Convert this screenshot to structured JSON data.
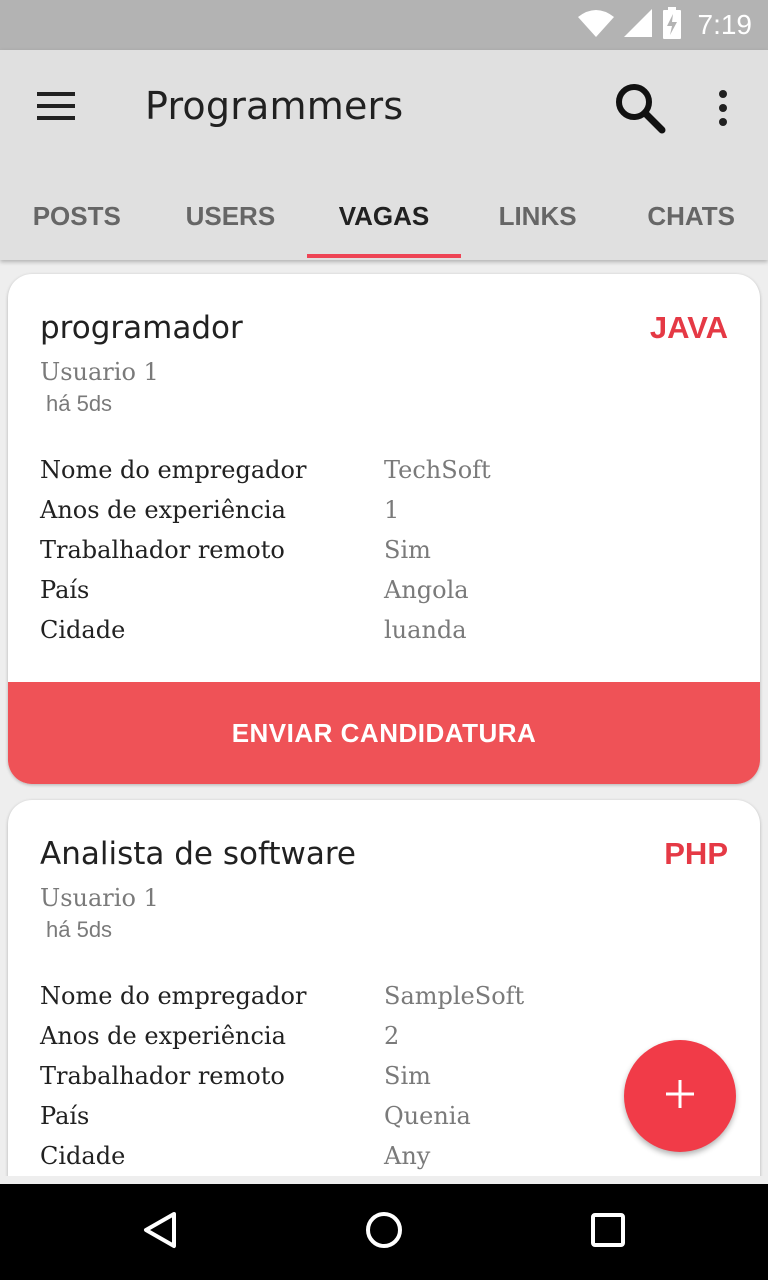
{
  "status_bar": {
    "time": "7:19",
    "icons": [
      "wifi-icon",
      "cell-signal-icon",
      "battery-charging-icon"
    ]
  },
  "app_bar": {
    "title": "Programmers",
    "icons": [
      "menu-icon",
      "search-icon",
      "more-vert-icon"
    ]
  },
  "tabs": [
    {
      "label": "POSTS",
      "active": false
    },
    {
      "label": "USERS",
      "active": false
    },
    {
      "label": "VAGAS",
      "active": true
    },
    {
      "label": "LINKS",
      "active": false
    },
    {
      "label": "CHATS",
      "active": false
    }
  ],
  "jobs": [
    {
      "title": "programador",
      "language": "JAVA",
      "author": "Usuario 1",
      "time_ago": "há 5ds",
      "details": [
        {
          "key": "Nome do empregador",
          "value": "TechSoft"
        },
        {
          "key": "Anos de experiência",
          "value": "1"
        },
        {
          "key": "Trabalhador remoto",
          "value": "Sim"
        },
        {
          "key": "País",
          "value": "Angola"
        },
        {
          "key": "Cidade",
          "value": "luanda"
        }
      ],
      "button": "ENVIAR CANDIDATURA"
    },
    {
      "title": "Analista de software",
      "language": "PHP",
      "author": "Usuario 1",
      "time_ago": "há 5ds",
      "details": [
        {
          "key": "Nome do empregador",
          "value": "SampleSoft"
        },
        {
          "key": "Anos de experiência",
          "value": "2"
        },
        {
          "key": "Trabalhador remoto",
          "value": "Sim"
        },
        {
          "key": "País",
          "value": "Quenia"
        },
        {
          "key": "Cidade",
          "value": "Any"
        }
      ]
    }
  ],
  "fab": {
    "icon": "add-icon",
    "symbol": "+"
  },
  "nav_bar": {
    "icons": [
      "back-icon",
      "home-icon",
      "recents-icon"
    ]
  },
  "colors": {
    "accent": "#e53945",
    "button": "#ef5257",
    "fab": "#f13b48",
    "app_bar": "#e0e0e0",
    "status_bar": "#b3b3b3"
  }
}
